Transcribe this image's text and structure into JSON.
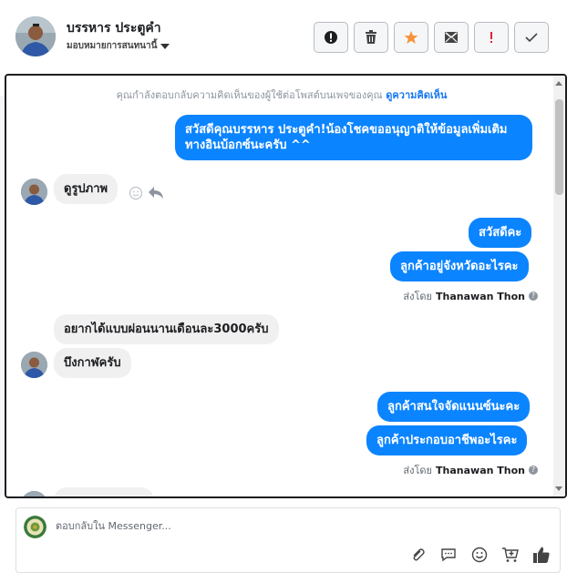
{
  "header": {
    "customer_name": "บรรหาร ประตูคำ",
    "assign_label": "มอบหมายการสนทนานี้"
  },
  "toolbar": {
    "buttons": [
      "alert",
      "delete",
      "star",
      "mark-unread",
      "important",
      "done"
    ]
  },
  "thread": {
    "notice_text": "คุณกำลังตอบกลับความคิดเห็นของผู้ใช้ต่อโพสต์บนเพจของคุณ ",
    "notice_link": "ดูความคิดเห็น",
    "messages": {
      "out_1": "สวัสดีคุณบรรหาร ประตูคำ!น้องโชคขออนุญาติให้ข้อมูลเพิ่มเติมทางอินบ้อกซ์นะครับ ^^",
      "in_1": "ดูรูปภาพ",
      "out_2": "สวัสดีคะ",
      "out_3": "ลูกค้าอยู่จังหวัดอะไรคะ",
      "sentby_label_1": "ส่งโดย",
      "sentby_name_1": "Thanawan Thon",
      "in_2": "อยากได้แบบผ่อนนานเดือนละ3000ครับ",
      "in_3": "บึงกาฬครับ",
      "out_4": "ลูกค้าสนใจจัดแนนซ์นะคะ",
      "out_5": "ลูกค้าประกอบอาชีพอะไรคะ",
      "sentby_label_2": "ส่งโดย",
      "sentby_name_2": "Thanawan Thon"
    }
  },
  "reply": {
    "placeholder": "ตอบกลับใน Messenger..."
  },
  "colors": {
    "outgoing": "#0b84ff",
    "incoming": "#f0f0f0",
    "star": "#f7923a",
    "important": "#e41e3f"
  }
}
